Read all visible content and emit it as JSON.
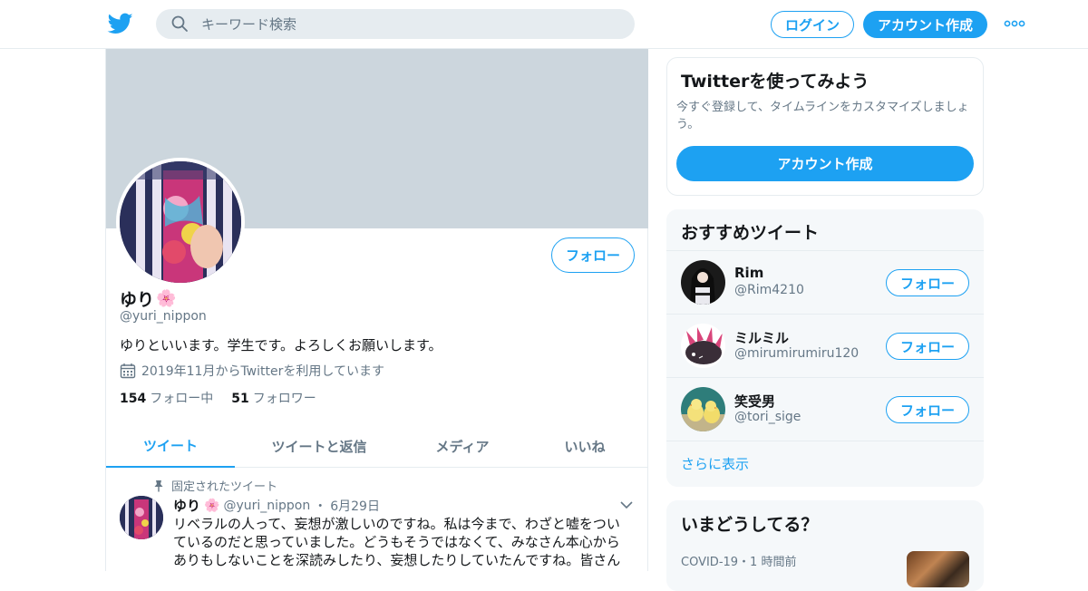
{
  "header": {
    "search_placeholder": "キーワード検索",
    "login_label": "ログイン",
    "signup_label": "アカウント作成",
    "brand_color": "#1da1f2"
  },
  "profile": {
    "name": "ゆり",
    "name_emoji": "🌸",
    "handle": "@yuri_nippon",
    "bio": "ゆりといいます。学生です。よろしくお願いします。",
    "joined": "2019年11月からTwitterを利用しています",
    "following_count": "154",
    "following_label": "フォロー中",
    "followers_count": "51",
    "followers_label": "フォロワー",
    "follow_label": "フォロー"
  },
  "tabs": [
    {
      "label": "ツイート",
      "active": true
    },
    {
      "label": "ツイートと返信",
      "active": false
    },
    {
      "label": "メディア",
      "active": false
    },
    {
      "label": "いいね",
      "active": false
    }
  ],
  "tweet": {
    "pinned_label": "固定されたツイート",
    "name": "ゆり",
    "name_emoji": "🌸",
    "handle": "@yuri_nippon",
    "separator": "・",
    "date": "6月29日",
    "text": "リベラルの人って、妄想が激しいのですね。私は今まで、わざと嘘をついているのだと思っていました。どうもそうではなくて、みなさん本心からありもしないことを深読みしたり、妄想したりしていたんですね。皆さん"
  },
  "signup_card": {
    "title": "Twitterを使ってみよう",
    "text": "今すぐ登録して、タイムラインをカスタマイズしましょう。",
    "button_label": "アカウント作成"
  },
  "recommended": {
    "title": "おすすめツイート",
    "users": [
      {
        "name": "Rim",
        "handle": "@Rim4210",
        "follow_label": "フォロー"
      },
      {
        "name": "ミルミル",
        "handle": "@mirumirumiru120",
        "follow_label": "フォロー"
      },
      {
        "name": "笑受男",
        "handle": "@tori_sige",
        "follow_label": "フォロー"
      }
    ],
    "more_label": "さらに表示"
  },
  "trends": {
    "title": "いまどうしてる？",
    "meta": "COVID-19・1 時間前"
  }
}
